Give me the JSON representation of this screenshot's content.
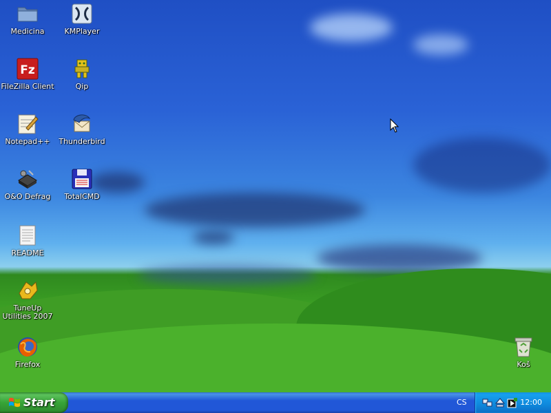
{
  "desktop": {
    "icons": [
      {
        "label": "Medicina",
        "icon": "folder-icon"
      },
      {
        "label": "KMPlayer",
        "icon": "kmplayer-icon"
      },
      {
        "label": "FileZilla Client",
        "icon": "filezilla-icon"
      },
      {
        "label": "Qip",
        "icon": "qip-icon"
      },
      {
        "label": "Notepad++",
        "icon": "notepad-icon"
      },
      {
        "label": "Thunderbird",
        "icon": "thunderbird-icon"
      },
      {
        "label": "O&O Defrag",
        "icon": "defrag-icon"
      },
      {
        "label": "TotalCMD",
        "icon": "totalcmd-icon"
      },
      {
        "label": "README",
        "icon": "text-document-icon"
      },
      {
        "label": "TuneUp Utilities 2007",
        "icon": "tuneup-icon"
      },
      {
        "label": "Firefox",
        "icon": "firefox-icon"
      },
      {
        "label": "Koš",
        "icon": "recycle-bin-icon"
      }
    ]
  },
  "taskbar": {
    "start_label": "Start",
    "language": "CS",
    "clock": "12:00"
  },
  "colors": {
    "taskbar": "#2157d7",
    "start_button": "#37a437",
    "tray": "#0f88dc"
  }
}
